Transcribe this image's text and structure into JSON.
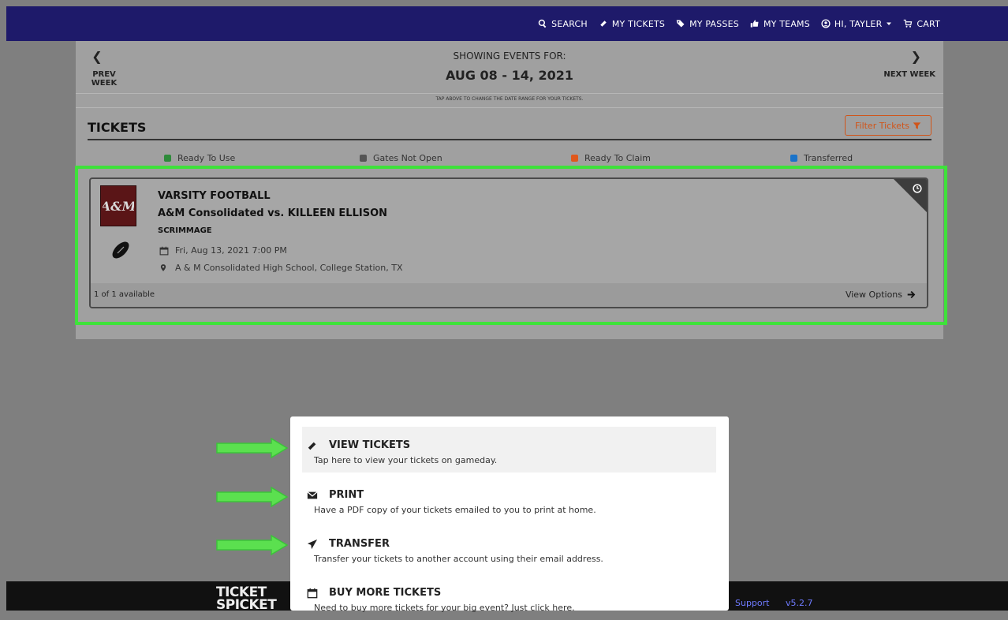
{
  "nav": {
    "search": "SEARCH",
    "my_tickets": "MY TICKETS",
    "my_passes": "MY PASSES",
    "my_teams": "MY TEAMS",
    "user": "HI, TAYLER",
    "cart": "CART"
  },
  "week": {
    "prev_label": "PREV WEEK",
    "next_label": "NEXT WEEK",
    "showing_label": "SHOWING EVENTS FOR:",
    "range": "AUG 08 - 14, 2021",
    "hint": "TAP ABOVE TO CHANGE THE DATE RANGE FOR YOUR TICKETS."
  },
  "tickets": {
    "title": "TICKETS",
    "filter_label": "Filter Tickets"
  },
  "legend": [
    {
      "label": "Ready To Use",
      "color": "#2e8b3a"
    },
    {
      "label": "Gates Not Open",
      "color": "#555555"
    },
    {
      "label": "Ready To Claim",
      "color": "#e0581c"
    },
    {
      "label": "Transferred",
      "color": "#1a73c9"
    }
  ],
  "event": {
    "sport": "VARSITY FOOTBALL",
    "matchup": "A&M Consolidated vs. KILLEEN ELLISON",
    "type": "SCRIMMAGE",
    "datetime": "Fri, Aug 13, 2021 7:00 PM",
    "location": "A & M Consolidated High School, College Station, TX",
    "availability": "1 of 1 available",
    "view_options": "View Options"
  },
  "menu": {
    "items": [
      {
        "title": "VIEW TICKETS",
        "desc": "Tap here to view your tickets on gameday.",
        "icon": "ticket-icon"
      },
      {
        "title": "PRINT",
        "desc": "Have a PDF copy of your tickets emailed to you to print at home.",
        "icon": "envelope-icon"
      },
      {
        "title": "TRANSFER",
        "desc": "Transfer your tickets to another account using their email address.",
        "icon": "paper-plane-icon"
      },
      {
        "title": "BUY MORE TICKETS",
        "desc": "Need to buy more tickets for your big event? Just click here.",
        "icon": "calendar-icon"
      }
    ]
  },
  "footer": {
    "logo_line1": "TICKET",
    "logo_line2": "SPICKET",
    "support": "Support",
    "version": "v5.2.7"
  },
  "colors": {
    "nav_bg": "#1e1a6a",
    "highlight": "#3ee23a",
    "filter_accent": "#d0551a"
  }
}
